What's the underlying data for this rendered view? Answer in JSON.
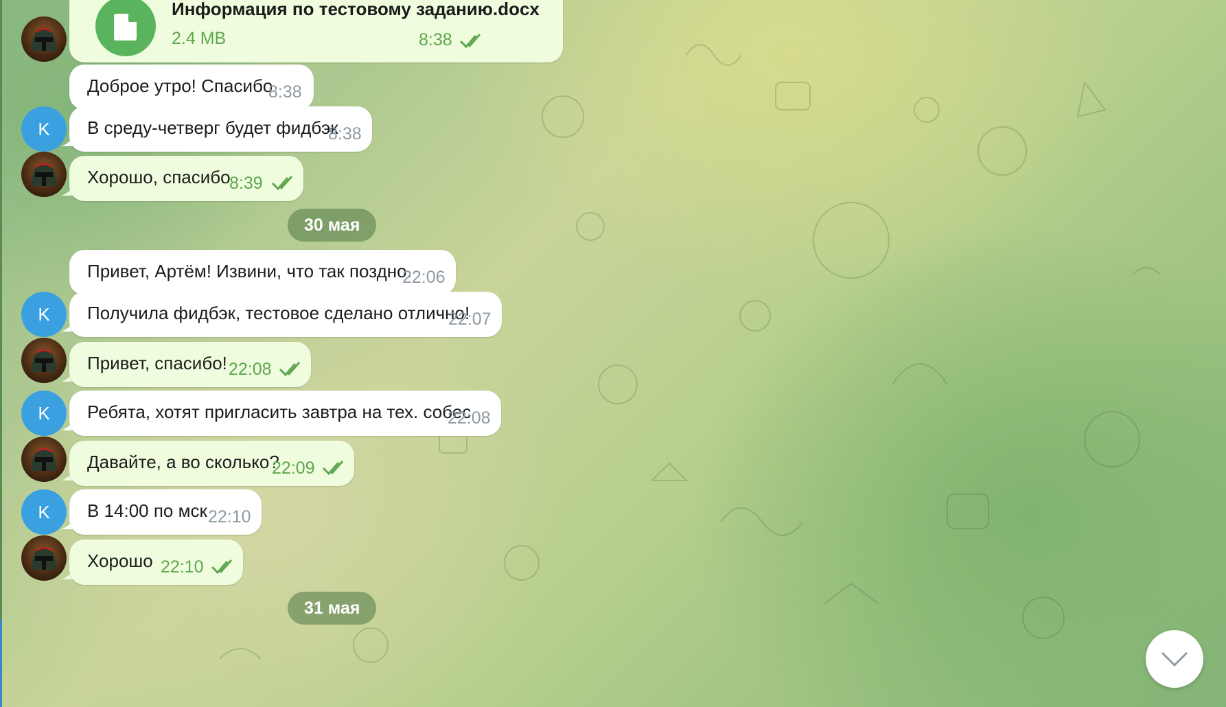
{
  "file_message": {
    "name": "Информация по тестовому заданию.docx",
    "size": "2.4 MB",
    "time": "8:38",
    "status_icon": "double-check-icon"
  },
  "messages": [
    {
      "sender": "contact",
      "text": "Доброе утро! Спасибо",
      "time": "8:38"
    },
    {
      "sender": "contact",
      "text": "В среду-четверг будет фидбэк",
      "time": "8:38",
      "avatar_letter": "K"
    },
    {
      "sender": "me",
      "text": "Хорошо, спасибо",
      "time": "8:39",
      "status_icon": "double-check-icon"
    },
    {
      "sender": "contact",
      "text": "Привет, Артём! Извини, что так поздно.",
      "time": "22:06"
    },
    {
      "sender": "contact",
      "text": "Получила фидбэк, тестовое сделано отлично!",
      "time": "22:07",
      "avatar_letter": "K"
    },
    {
      "sender": "me",
      "text": "Привет, спасибо!",
      "time": "22:08",
      "status_icon": "double-check-icon"
    },
    {
      "sender": "contact",
      "text": "Ребята, хотят пригласить завтра на тех. собес",
      "time": "22:08",
      "avatar_letter": "K"
    },
    {
      "sender": "me",
      "text": "Давайте, а во сколько?",
      "time": "22:09",
      "status_icon": "double-check-icon"
    },
    {
      "sender": "contact",
      "text": "В 14:00 по мск",
      "time": "22:10",
      "avatar_letter": "K"
    },
    {
      "sender": "me",
      "text": "Хорошо",
      "time": "22:10",
      "status_icon": "double-check-icon"
    }
  ],
  "date_separators": [
    "30 мая",
    "31 мая"
  ],
  "scroll_button": {
    "icon": "chevron-down-icon"
  },
  "colors": {
    "incoming_bubble": "#ffffff",
    "outgoing_bubble": "#effdde",
    "outgoing_time": "#5ea64f",
    "incoming_time": "#8e9aa3",
    "avatar_k": "#3ba0e0",
    "file_icon": "#5ab45d"
  }
}
